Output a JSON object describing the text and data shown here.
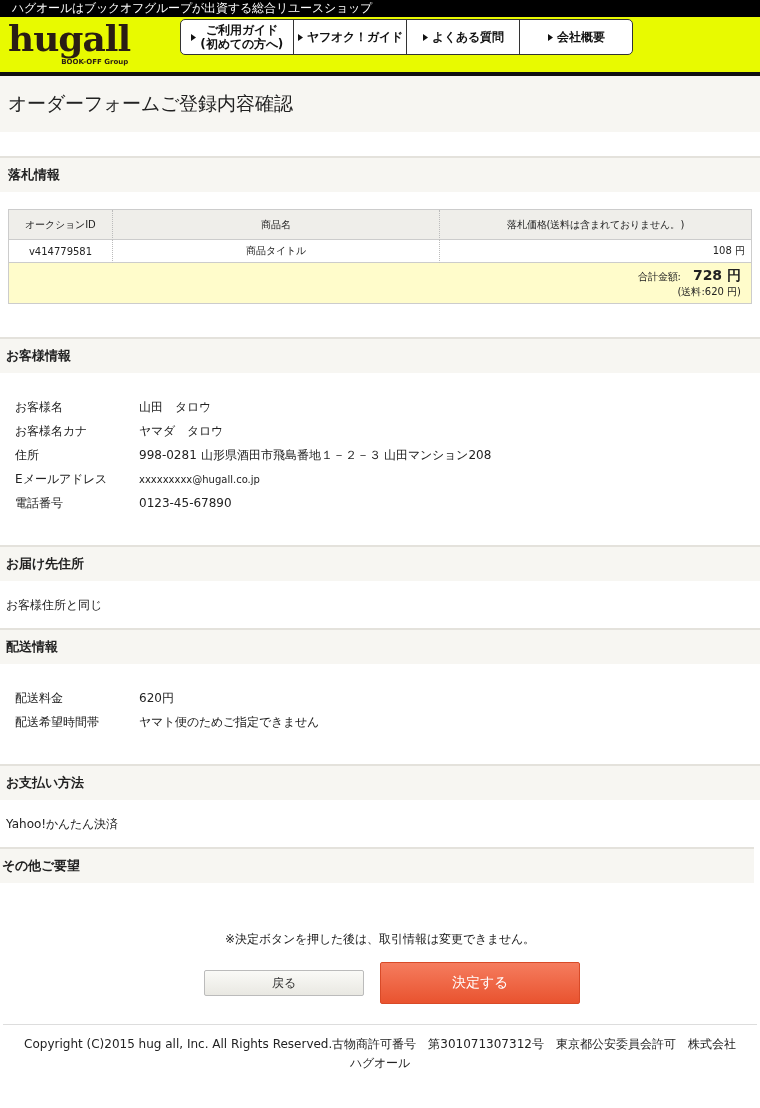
{
  "top_bar": {
    "tagline": "ハグオールはブックオフグループが出資する総合リユースショップ"
  },
  "logo": {
    "name": "hugall",
    "sub": "BOOK-OFF",
    "group": "Group"
  },
  "nav": [
    {
      "lines": [
        "ご利用ガイド",
        "(初めての方へ)"
      ]
    },
    {
      "lines": [
        "ヤフオク！ガイド"
      ]
    },
    {
      "lines": [
        "よくある質問"
      ]
    },
    {
      "lines": [
        "会社概要"
      ]
    }
  ],
  "page_title": "オーダーフォームご登録内容確認",
  "bid_section": {
    "heading": "落札情報",
    "table": {
      "columns": [
        "オークションID",
        "商品名",
        "落札価格(送料は含まれておりません。)"
      ],
      "rows": [
        [
          "v414779581",
          "商品タイトル",
          "108 円"
        ]
      ],
      "total_label": "合計金額:",
      "total": "728 円",
      "shipping_note": "(送料:620 円)"
    }
  },
  "customer_section": {
    "heading": "お客様情報",
    "fields": [
      {
        "label": "お客様名",
        "value": "山田　タロウ"
      },
      {
        "label": "お客様名カナ",
        "value": "ヤマダ　タロウ"
      },
      {
        "label": "住所",
        "value": "998-0281  山形県酒田市飛島番地１－２－３  山田マンション208"
      },
      {
        "label": "Eメールアドレス",
        "value": "xxxxxxxxx@hugall.co.jp"
      },
      {
        "label": "電話番号",
        "value": "0123-45-67890"
      }
    ]
  },
  "delivery_address_section": {
    "heading": "お届け先住所",
    "text": "お客様住所と同じ"
  },
  "shipping_section": {
    "heading": "配送情報",
    "fields": [
      {
        "label": "配送料金",
        "value": "620円"
      },
      {
        "label": "配送希望時間帯",
        "value": "ヤマト便のためご指定できません"
      }
    ]
  },
  "payment_section": {
    "heading": "お支払い方法",
    "text": "Yahoo!かんたん決済"
  },
  "other_section": {
    "heading": "その他ご要望"
  },
  "notice": "※決定ボタンを押した後は、取引情報は変更できません。",
  "buttons": [
    {
      "kind": "back",
      "label": "戻る"
    },
    {
      "kind": "submit",
      "label": "決定する"
    }
  ],
  "footer": "Copyright (C)2015 hug all, Inc. All Rights Reserved.古物商許可番号　第301071307312号　東京都公安委員会許可　株式会社ハグオール"
}
